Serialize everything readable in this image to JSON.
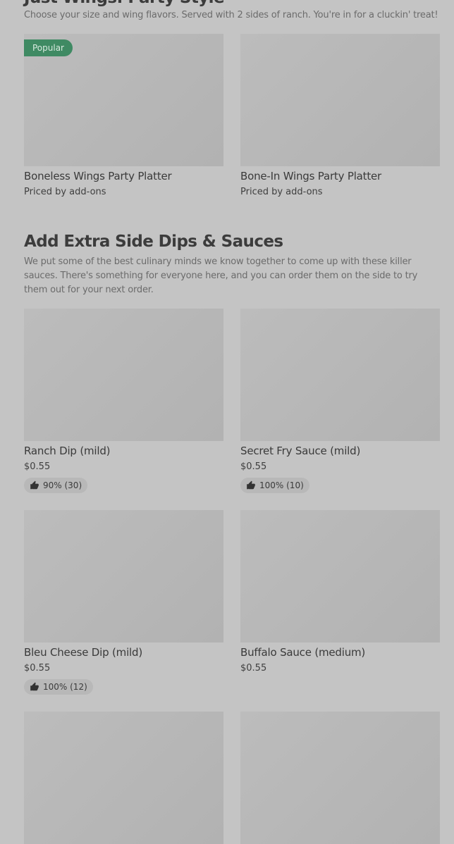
{
  "wings_section": {
    "title": "Just Wings: Party Style",
    "description": "Choose your size and wing flavors. Served with 2 sides of ranch. You're in for a cluckin' treat!",
    "items": [
      {
        "name": "Boneless Wings Party Platter",
        "price": "Priced by add-ons",
        "badge": "Popular"
      },
      {
        "name": "Bone-In Wings Party Platter",
        "price": "Priced by add-ons"
      }
    ]
  },
  "dips_section": {
    "title": "Add Extra Side Dips & Sauces",
    "description": "We put some of the best culinary minds we know together to come up with these killer sauces. There's something for everyone here, and you can order them on the side to try them out for your next order.",
    "items": [
      {
        "name": "Ranch Dip (mild)",
        "price": "$0.55",
        "rating": "90% (30)",
        "icon": "thumbs-up-icon"
      },
      {
        "name": "Secret Fry Sauce (mild)",
        "price": "$0.55",
        "rating": "100% (10)",
        "icon": "thumbs-up-icon"
      },
      {
        "name": "Bleu Cheese Dip (mild)",
        "price": "$0.55",
        "rating": "100% (12)",
        "icon": "thumbs-up-icon"
      },
      {
        "name": "Buffalo Sauce (medium)",
        "price": "$0.55"
      }
    ]
  },
  "colors": {
    "background": "#c4c4c4",
    "image_placeholder": "#b8b8b8",
    "badge": "#3f8a63",
    "rating_pill": "#b8b8b8"
  }
}
